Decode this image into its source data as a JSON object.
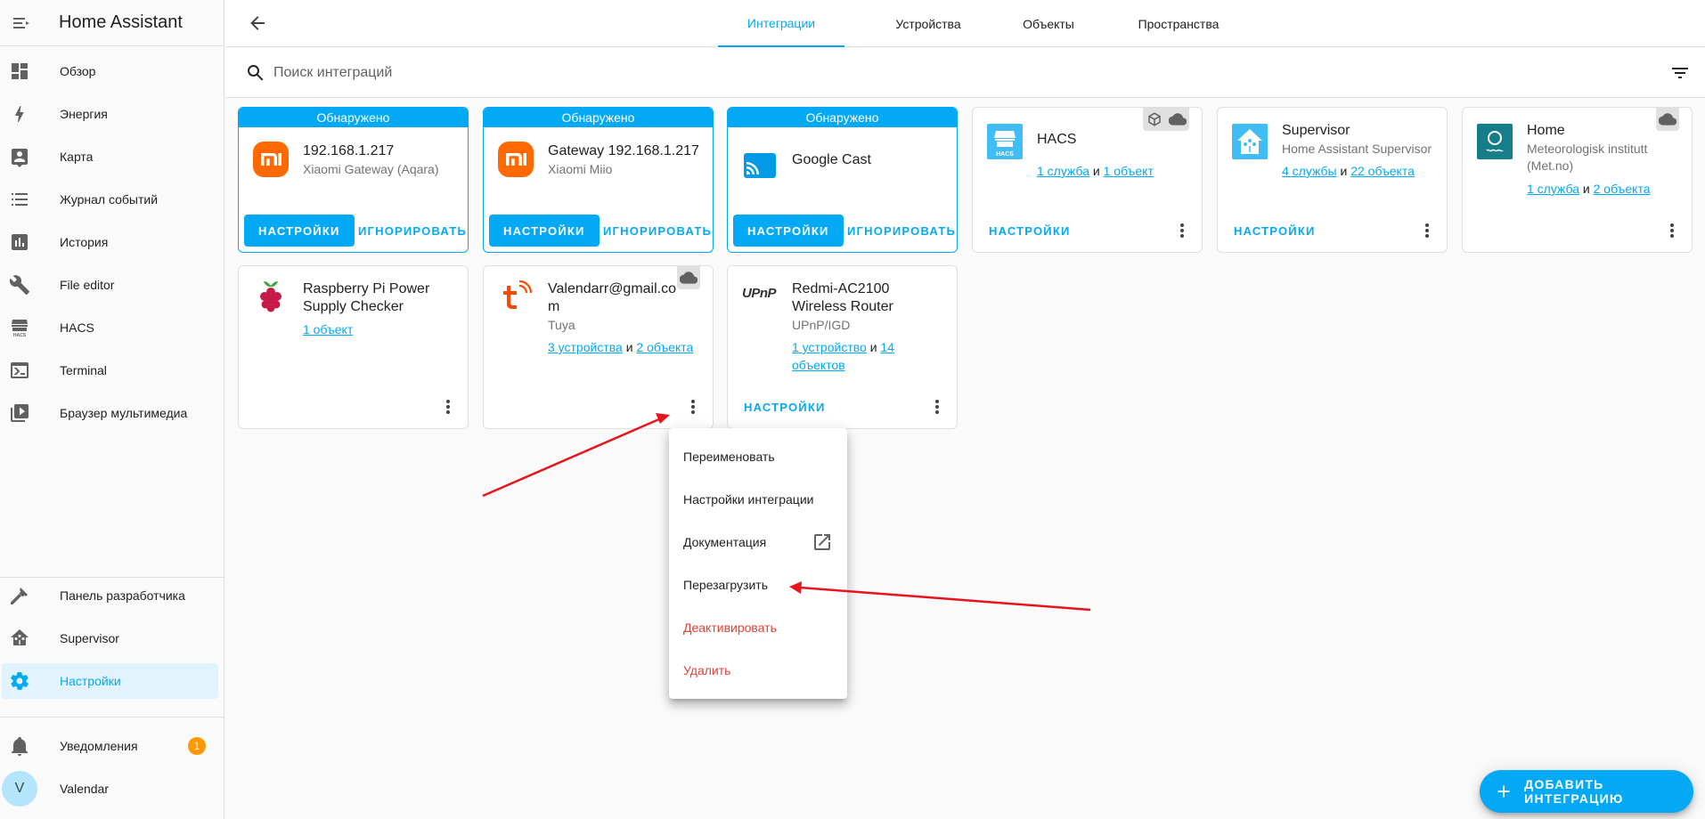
{
  "sidebar": {
    "title": "Home Assistant",
    "items": [
      {
        "label": "Обзор",
        "icon": "dashboard-icon"
      },
      {
        "label": "Энергия",
        "icon": "lightning-icon"
      },
      {
        "label": "Карта",
        "icon": "map-account-icon"
      },
      {
        "label": "Журнал событий",
        "icon": "list-icon"
      },
      {
        "label": "История",
        "icon": "chart-box-icon"
      },
      {
        "label": "File editor",
        "icon": "wrench-icon"
      },
      {
        "label": "HACS",
        "icon": "hacs-icon"
      },
      {
        "label": "Terminal",
        "icon": "console-icon"
      },
      {
        "label": "Браузер мультимедиа",
        "icon": "play-box-icon"
      }
    ],
    "bottom_items": [
      {
        "label": "Панель разработчика",
        "icon": "hammer-icon"
      },
      {
        "label": "Supervisor",
        "icon": "home-assistant-icon"
      },
      {
        "label": "Настройки",
        "icon": "cog-icon"
      }
    ],
    "notifications": {
      "label": "Уведомления",
      "count": "1"
    },
    "user": {
      "label": "Valendar",
      "initial": "V"
    }
  },
  "tabs": [
    "Интеграции",
    "Устройства",
    "Объекты",
    "Пространства"
  ],
  "search": {
    "placeholder": "Поиск интеграций"
  },
  "discovered_label": "Обнаружено",
  "buttons": {
    "configure": "НАСТРОЙКИ",
    "ignore": "ИГНОРИРОВАТЬ",
    "settings": "НАСТРОЙКИ"
  },
  "cards": {
    "c1": {
      "title": "192.168.1.217",
      "subtitle": "Xiaomi Gateway (Aqara)"
    },
    "c2": {
      "title": "Gateway 192.168.1.217",
      "subtitle": "Xiaomi Miio"
    },
    "c3": {
      "title": "Google Cast"
    },
    "c4": {
      "title": "HACS",
      "link1": "1 служба",
      "sep": "и",
      "link2": "1 объект"
    },
    "c5": {
      "title": "Supervisor",
      "subtitle": "Home Assistant Supervisor",
      "link1": "4 службы",
      "sep": "и",
      "link2": "22 объекта"
    },
    "c6": {
      "title": "Home",
      "subtitle": "Meteorologisk institutt (Met.no)",
      "link1": "1 служба",
      "sep": "и",
      "link2": "2 объекта"
    },
    "c7": {
      "title": "Raspberry Pi Power Supply Checker",
      "link1": "1 объект"
    },
    "c8": {
      "title": "Valendarr@gmail.com",
      "subtitle": "Tuya",
      "link1": "3 устройства",
      "sep": "и",
      "link2": "2 объекта"
    },
    "c9": {
      "title": "Redmi-AC2100 Wireless Router",
      "subtitle": "UPnP/IGD",
      "link1": "1 устройство",
      "sep": "и",
      "link2": "14 объектов",
      "logo_text": "UPnP"
    }
  },
  "menu": [
    "Переименовать",
    "Настройки интеграции",
    "Документация",
    "Перезагрузить",
    "Деактивировать",
    "Удалить"
  ],
  "fab": {
    "label": "ДОБАВИТЬ ИНТЕГРАЦИЮ"
  },
  "colors": {
    "accent": "#03a9f4",
    "danger": "#db4437",
    "badge": "#ff9800",
    "annotation": "#e8141b"
  }
}
